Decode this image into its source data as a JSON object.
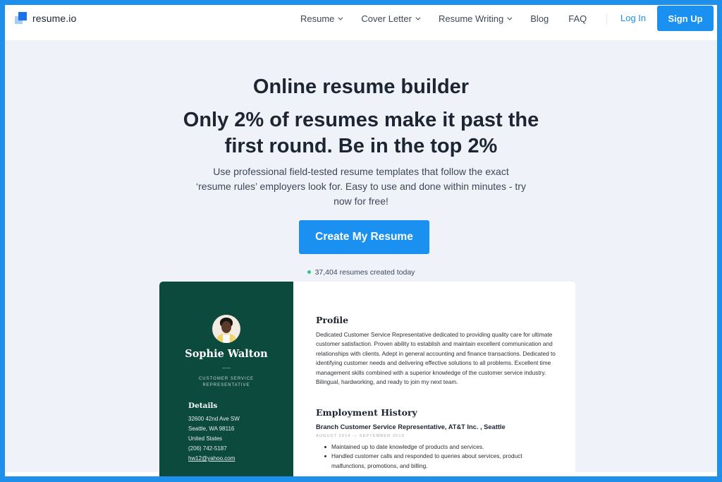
{
  "brand": {
    "name": "resume.io",
    "logo_icon": "stacked-squares-logo-icon",
    "accent": "#1a91f0",
    "frame_color": "#1f8fec"
  },
  "nav": {
    "items": [
      {
        "label": "Resume",
        "has_dropdown": true
      },
      {
        "label": "Cover Letter",
        "has_dropdown": true
      },
      {
        "label": "Resume Writing",
        "has_dropdown": true
      },
      {
        "label": "Blog",
        "has_dropdown": false
      },
      {
        "label": "FAQ",
        "has_dropdown": false
      }
    ],
    "login_label": "Log In",
    "signup_label": "Sign Up"
  },
  "hero": {
    "title": "Online resume builder",
    "subtitle": "Only 2% of resumes make it past the first round. Be in the top 2%",
    "description": "Use professional field-tested resume templates that follow the exact ‘resume rules’ employers look for. Easy to use and done within minutes - try now for free!",
    "cta_label": "Create My Resume",
    "counter_text": "37,404 resumes created today",
    "counter_dot_color": "#33c481"
  },
  "resume_preview": {
    "sidebar_color": "#0c4a3e",
    "name": "Sophie Walton",
    "role": "CUSTOMER SERVICE REPRESENTATIVE",
    "details_title": "Details",
    "details": {
      "address_line1": "32600 42nd Ave SW",
      "address_line2": "Seattle, WA 98116",
      "country": "United States",
      "phone": "(206) 742-5187",
      "email": "hw12@yahoo.com"
    },
    "profile_title": "Profile",
    "profile_text": "Dedicated Customer Service Representative dedicated to providing quality care for ultimate customer satisfaction. Proven ability to establish and maintain excellent communication and relationships with clients. Adept in general accounting and finance transactions. Dedicated to identifying customer needs and delivering effective solutions to all problems. Excellent time management skills combined with a superior knowledge of the customer service industry. Bilingual, hardworking, and ready to join my next team.",
    "employment_title": "Employment History",
    "job": {
      "title": "Branch Customer Service Representative, AT&T Inc. , Seattle",
      "dates": "AUGUST 2014 — SEPTEMBER 2019",
      "bullets": [
        "Maintained up to date knowledge of products and services.",
        "Handled customer calls and responded to queries about services, product malfunctions, promotions, and billing."
      ]
    }
  }
}
